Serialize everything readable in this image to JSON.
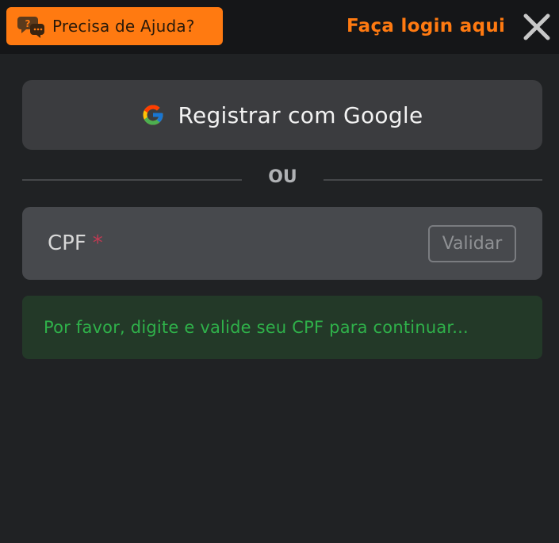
{
  "header": {
    "help_label": "Precisa de Ajuda?",
    "help_icon": "chat-help-icon",
    "login_label": "Faça login aqui",
    "close_icon": "close-icon"
  },
  "google_button": {
    "label": "Registrar com Google",
    "icon": "google-icon"
  },
  "divider": {
    "text": "OU"
  },
  "cpf_field": {
    "label": "CPF",
    "required_mark": "*",
    "validate_label": "Validar"
  },
  "notice": {
    "text": "Por favor, digite e valide seu CPF para continuar..."
  },
  "colors": {
    "accent": "#ff7a11",
    "background": "#202224",
    "topbar": "#151618",
    "success_text": "#2fb14a",
    "success_bg": "#233928",
    "required": "#c03a53"
  }
}
